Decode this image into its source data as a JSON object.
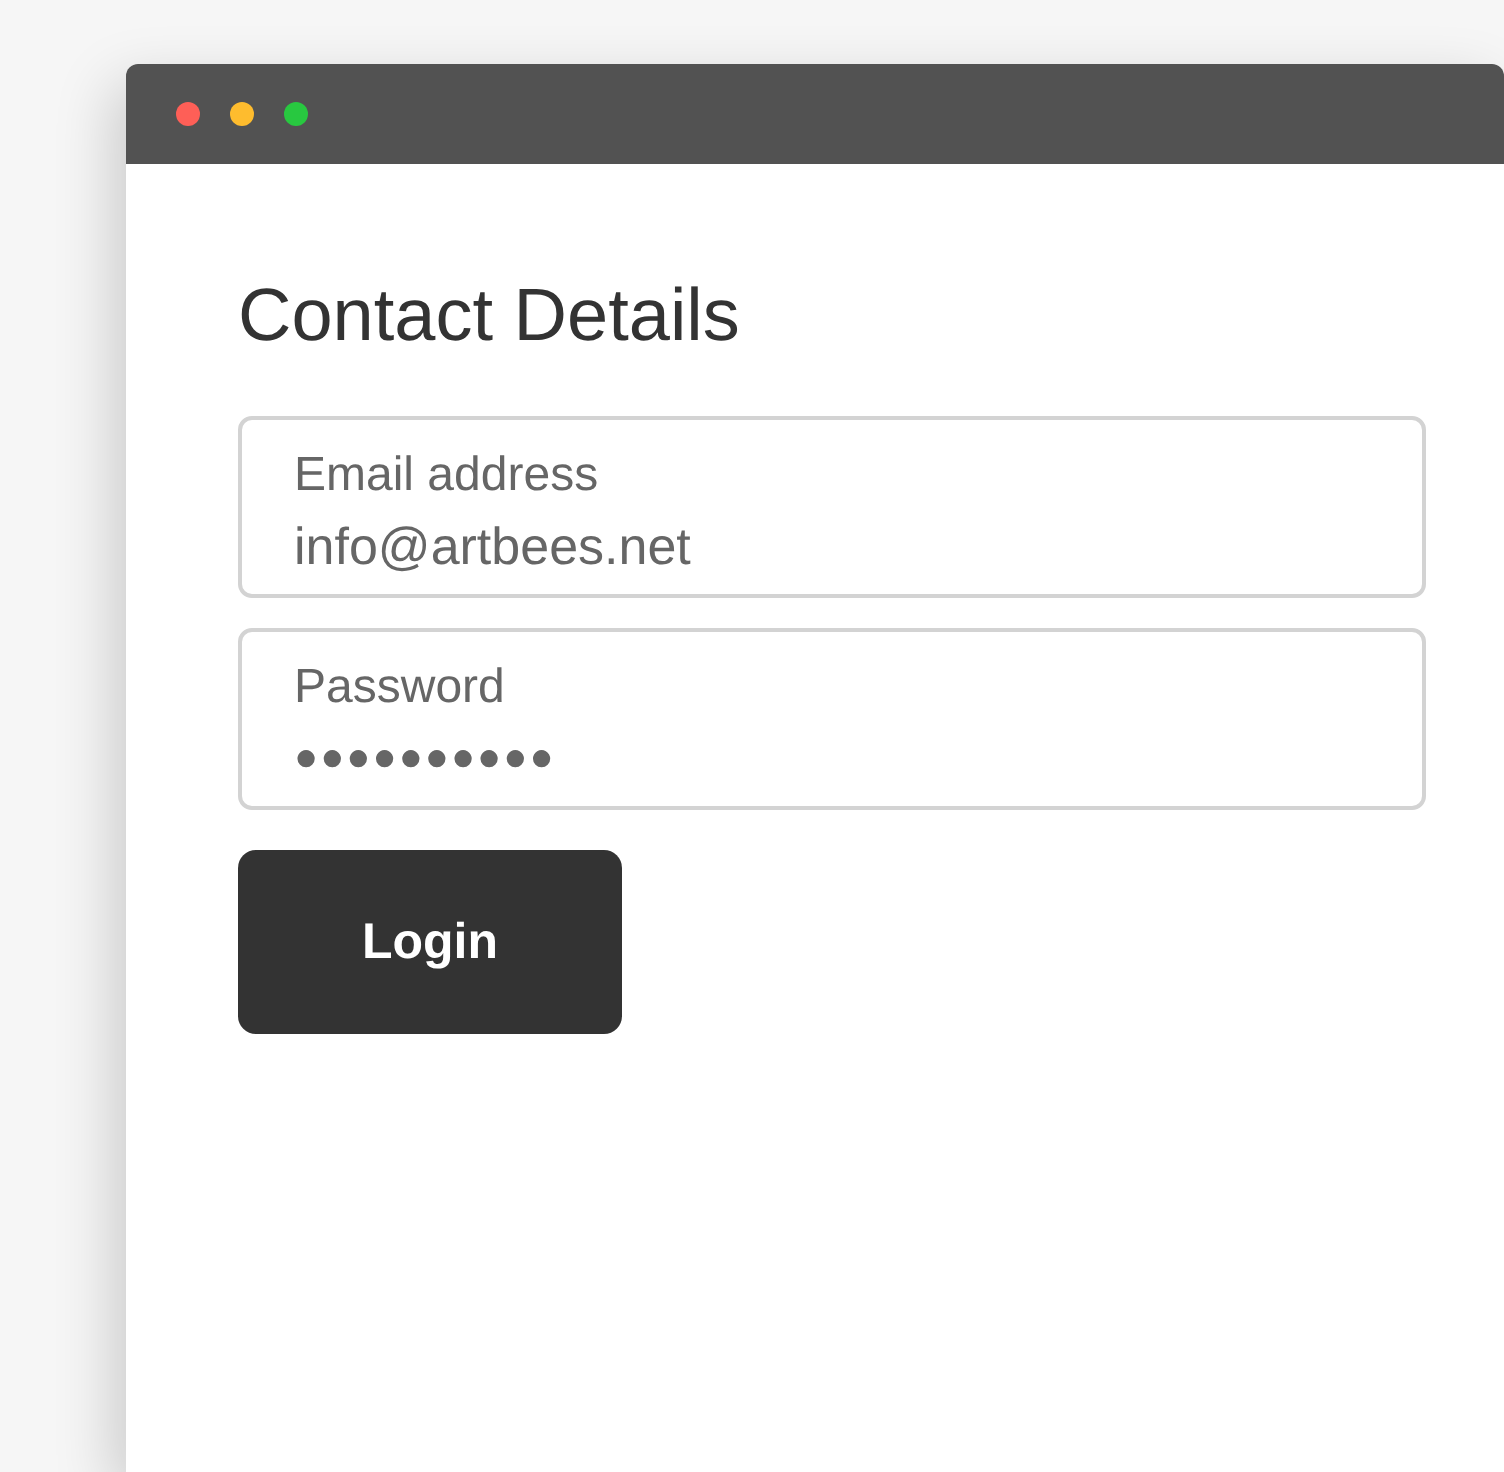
{
  "window": {
    "controls": [
      {
        "color": "#fe5f57"
      },
      {
        "color": "#febc2e"
      },
      {
        "color": "#28c840"
      }
    ]
  },
  "form": {
    "title": "Contact Details",
    "fields": [
      {
        "label": "Email address",
        "value": "info@artbees.net",
        "kind": "email"
      },
      {
        "label": "Password",
        "value": "●●●●●●●●●●",
        "kind": "password"
      }
    ],
    "button": "Login"
  }
}
